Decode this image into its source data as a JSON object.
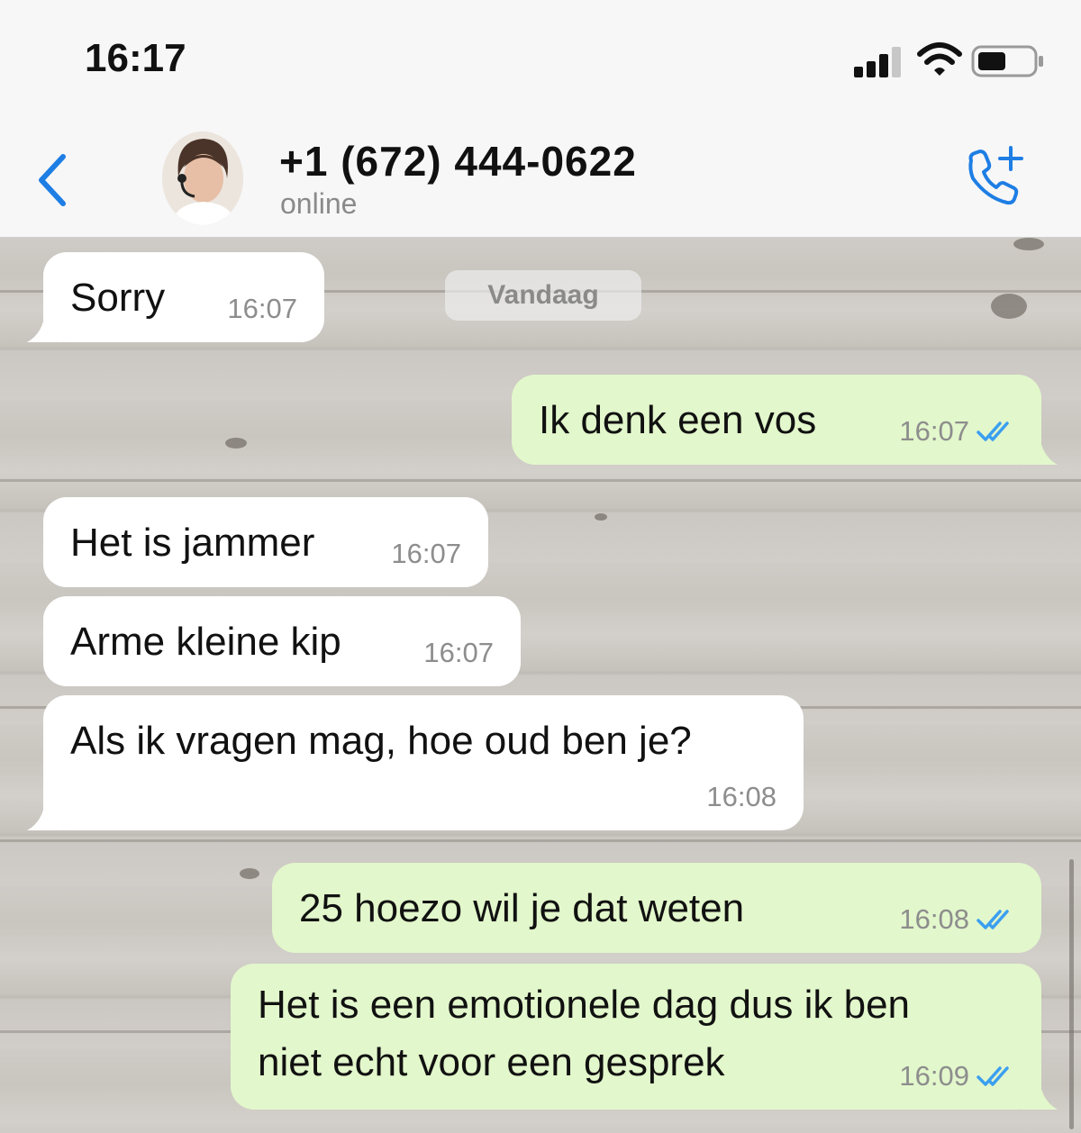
{
  "status_bar": {
    "time": "16:17",
    "icons": [
      "signal-icon",
      "wifi-icon",
      "battery-icon"
    ]
  },
  "header": {
    "contact_name": "+1 (672) 444-0622",
    "contact_status": "online",
    "back_icon": "chevron-left-icon",
    "call_icon": "add-call-icon"
  },
  "colors": {
    "accent": "#1e7ee4",
    "outgoing_bubble": "#e2f7cb",
    "incoming_bubble": "#ffffff",
    "read_ticks": "#3b9ff0"
  },
  "chat": {
    "date_separator": "Vandaag",
    "messages": [
      {
        "direction": "in",
        "text": "Sorry",
        "time": "16:07"
      },
      {
        "direction": "out",
        "text": "Ik denk een vos",
        "time": "16:07",
        "status": "read"
      },
      {
        "direction": "in",
        "text": "Het is jammer",
        "time": "16:07"
      },
      {
        "direction": "in",
        "text": "Arme kleine kip",
        "time": "16:07"
      },
      {
        "direction": "in",
        "text": "Als ik vragen mag, hoe oud ben je?",
        "time": "16:08"
      },
      {
        "direction": "out",
        "text": "25 hoezo wil je dat weten",
        "time": "16:08",
        "status": "read"
      },
      {
        "direction": "out",
        "text_lines": [
          "Het is een emotionele dag dus ik ben",
          "niet echt voor een gesprek"
        ],
        "time": "16:09",
        "status": "read"
      }
    ]
  }
}
